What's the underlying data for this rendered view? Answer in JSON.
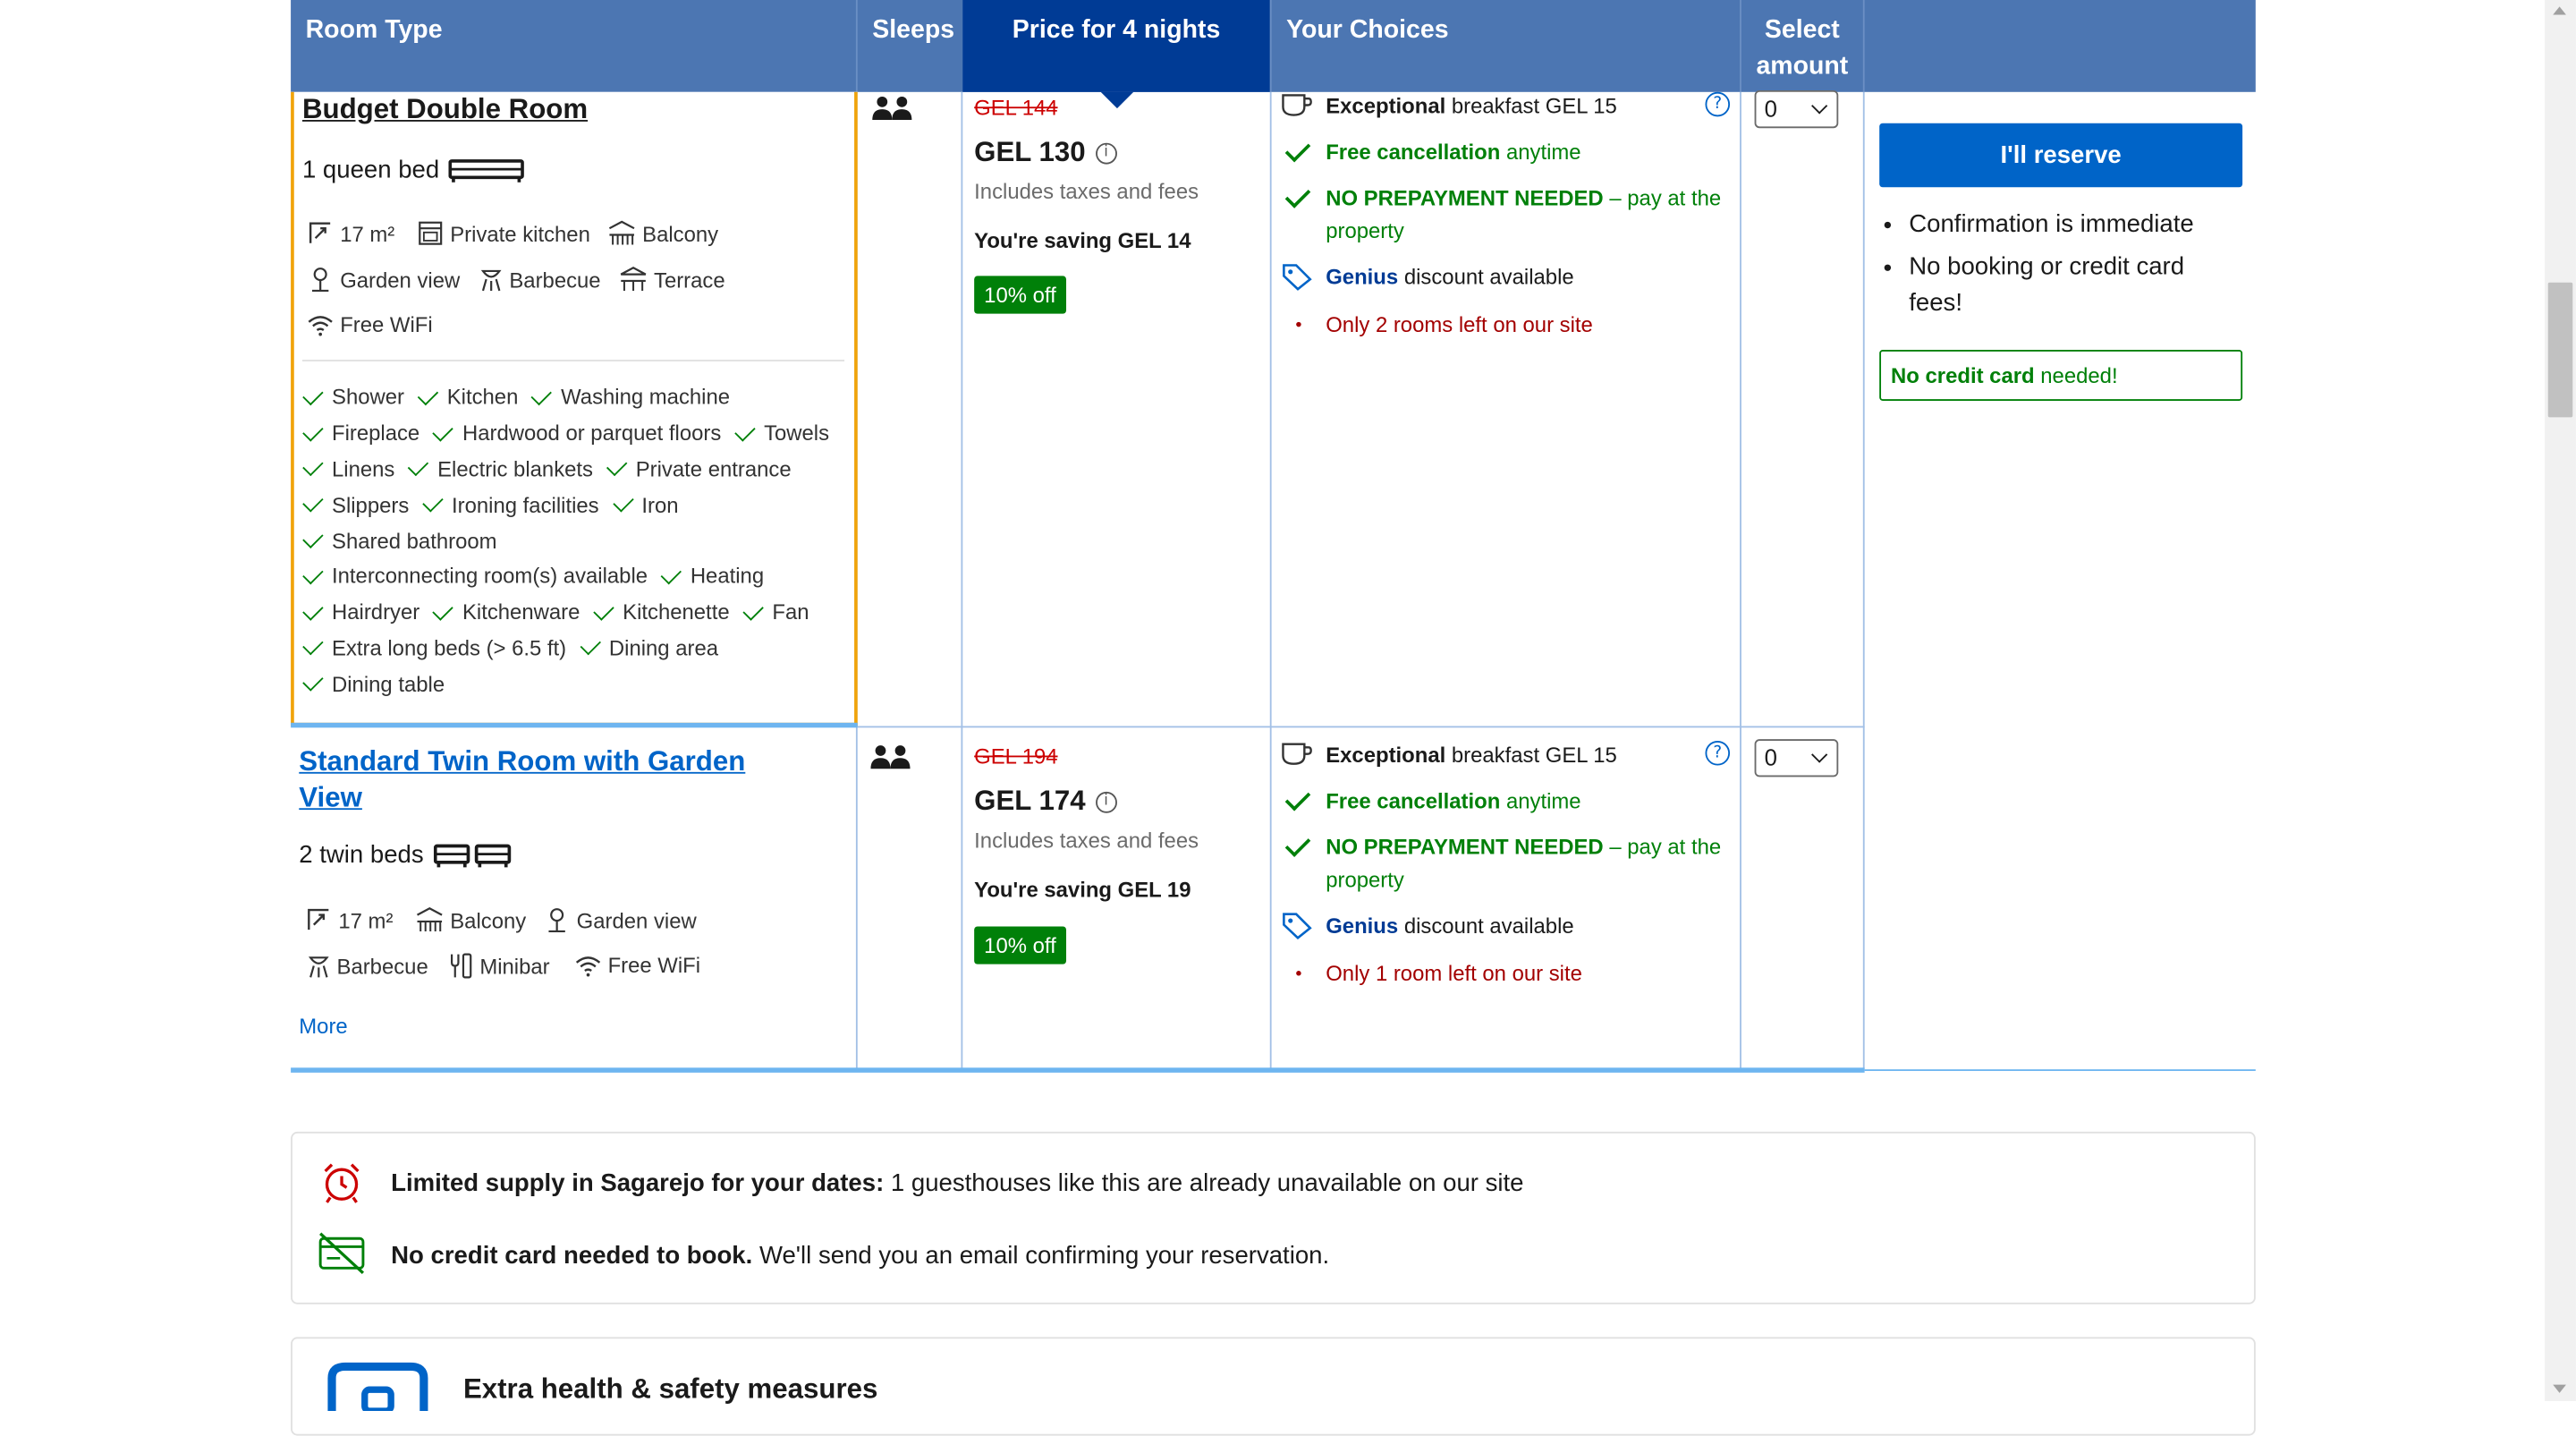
{
  "table": {
    "headers": {
      "room_type": "Room Type",
      "sleeps": "Sleeps",
      "price": "Price for 4 nights",
      "choices": "Your Choices",
      "select_amount": "Select amount"
    }
  },
  "rooms": [
    {
      "name": "Budget Double Room",
      "bed": "1 queen bed",
      "facilities": [
        {
          "icon": "size-icon",
          "label": "17 m²"
        },
        {
          "icon": "kitchen-icon",
          "label": "Private kitchen"
        },
        {
          "icon": "balcony-icon",
          "label": "Balcony"
        },
        {
          "icon": "garden-icon",
          "label": "Garden view"
        },
        {
          "icon": "barbecue-icon",
          "label": "Barbecue"
        },
        {
          "icon": "terrace-icon",
          "label": "Terrace"
        },
        {
          "icon": "wifi-icon",
          "label": "Free WiFi"
        }
      ],
      "amenities": [
        "Shower",
        "Kitchen",
        "Washing machine",
        "Fireplace",
        "Hardwood or parquet floors",
        "Towels",
        "Linens",
        "Electric blankets",
        "Private entrance",
        "Slippers",
        "Ironing facilities",
        "Iron",
        "Shared bathroom",
        "Interconnecting room(s) available",
        "Heating",
        "Hairdryer",
        "Kitchenware",
        "Kitchenette",
        "Fan",
        "Extra long beds (> 6.5 ft)",
        "Dining area",
        "Dining table"
      ],
      "old_price": "GEL 144",
      "price": "GEL 130",
      "taxes": "Includes taxes and fees",
      "saving": "You're saving GEL 14",
      "discount_badge": "10% off",
      "breakfast_bold": "Exceptional",
      "breakfast_rest": "breakfast GEL 15",
      "cancel_bold": "Free cancellation",
      "cancel_rest": "anytime",
      "prepay_bold": "NO PREPAYMENT NEEDED",
      "prepay_rest1": "– pay at the",
      "prepay_rest2": "property",
      "genius_bold": "Genius",
      "genius_rest": "discount available",
      "rooms_left": "Only 2 rooms left on our site",
      "select_value": "0"
    },
    {
      "name_line1": "Standard Twin Room with Garden",
      "name_line2": "View",
      "bed": "2 twin beds",
      "facilities": [
        {
          "icon": "size-icon",
          "label": "17 m²"
        },
        {
          "icon": "balcony-icon",
          "label": "Balcony"
        },
        {
          "icon": "garden-icon",
          "label": "Garden view"
        },
        {
          "icon": "barbecue-icon",
          "label": "Barbecue"
        },
        {
          "icon": "minibar-icon",
          "label": "Minibar"
        },
        {
          "icon": "wifi-icon",
          "label": "Free WiFi"
        }
      ],
      "more_link": "More",
      "old_price": "GEL 194",
      "price": "GEL 174",
      "taxes": "Includes taxes and fees",
      "saving": "You're saving GEL 19",
      "discount_badge": "10% off",
      "breakfast_bold": "Exceptional",
      "breakfast_rest": "breakfast GEL 15",
      "cancel_bold": "Free cancellation",
      "cancel_rest": "anytime",
      "prepay_bold": "NO PREPAYMENT NEEDED",
      "prepay_rest1": "– pay at the",
      "prepay_rest2": "property",
      "genius_bold": "Genius",
      "genius_rest": "discount available",
      "rooms_left": "Only 1 room left on our site",
      "select_value": "0"
    }
  ],
  "reserve": {
    "button_label": "I'll reserve",
    "bullets": [
      "Confirmation is immediate",
      "No booking or credit card fees!"
    ],
    "no_cc_bold": "No credit card",
    "no_cc_rest": "needed!"
  },
  "info": {
    "supply_bold": "Limited supply in Sagarejo for your dates:",
    "supply_rest": "1 guesthouses like this are already unavailable on our site",
    "nocc_bold": "No credit card needed to book.",
    "nocc_rest": "We'll send you an email confirming your reservation."
  },
  "health": {
    "title": "Extra health & safety measures"
  },
  "colors": {
    "header_blue": "#4c76b2",
    "dark_blue": "#003b95",
    "action_blue": "#0064c8",
    "green": "#008009",
    "red": "#cc0000",
    "orange_highlight": "#f0a30a"
  }
}
